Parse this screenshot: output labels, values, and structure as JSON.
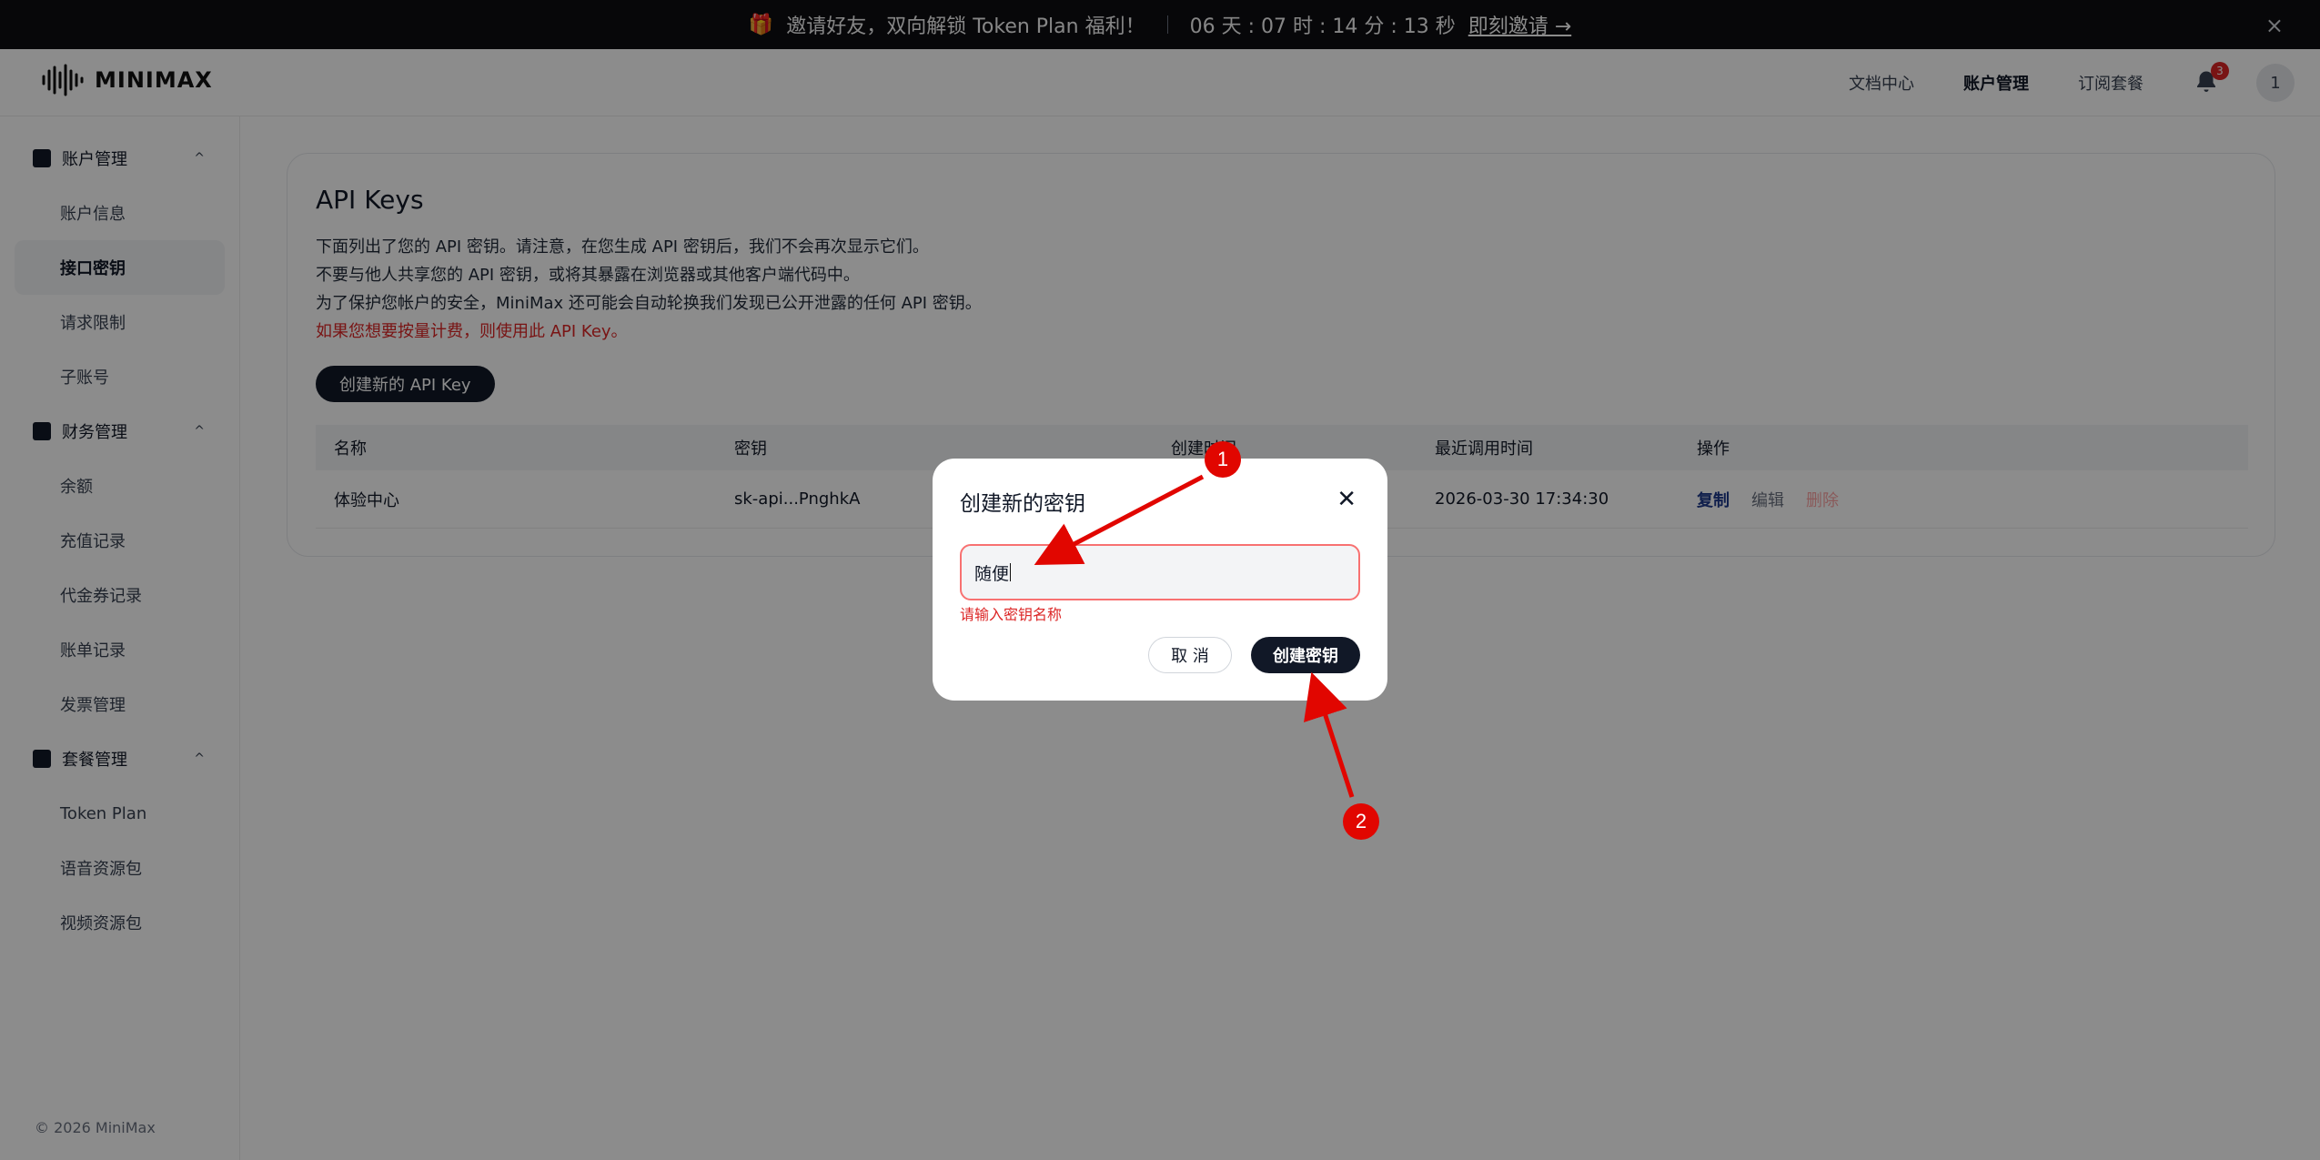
{
  "promo": {
    "text": "邀请好友，双向解锁 Token Plan 福利！",
    "countdown": "06 天 : 07 时 : 14 分 : 13 秒",
    "link": "即刻邀请 →",
    "close": "×"
  },
  "header": {
    "logo": "MINIMAX",
    "nav": [
      "文档中心",
      "账户管理",
      "订阅套餐"
    ],
    "notification_count": "3",
    "avatar": "1"
  },
  "sidebar": {
    "groups": [
      {
        "label": "账户管理",
        "items": [
          "账户信息",
          "接口密钥",
          "请求限制",
          "子账号"
        ]
      },
      {
        "label": "财务管理",
        "items": [
          "余额",
          "充值记录",
          "代金券记录",
          "账单记录",
          "发票管理"
        ]
      },
      {
        "label": "套餐管理",
        "items": [
          "Token Plan",
          "语音资源包",
          "视频资源包"
        ]
      }
    ],
    "active_item": "接口密钥",
    "footer": "© 2026 MiniMax"
  },
  "main": {
    "title": "API Keys",
    "desc": [
      "下面列出了您的 API 密钥。请注意，在您生成 API 密钥后，我们不会再次显示它们。",
      "不要与他人共享您的 API 密钥，或将其暴露在浏览器或其他客户端代码中。",
      "为了保护您帐户的安全，MiniMax 还可能会自动轮换我们发现已公开泄露的任何 API 密钥。"
    ],
    "warning": "如果您想要按量计费，则使用此 API Key。",
    "create_button": "创建新的 API Key",
    "table": {
      "headers": [
        "名称",
        "密钥",
        "创建时间",
        "最近调用时间",
        "操作"
      ],
      "rows": [
        {
          "name": "体验中心",
          "key": "sk-api...PnghkA",
          "created": "",
          "last_used": "2026-03-30 17:34:30",
          "actions": [
            "复制",
            "编辑",
            "删除"
          ]
        }
      ]
    }
  },
  "modal": {
    "title": "创建新的密钥",
    "input_value": "随便",
    "error": "请输入密钥名称",
    "cancel": "取 消",
    "confirm": "创建密钥"
  },
  "annotations": [
    "1",
    "2"
  ]
}
